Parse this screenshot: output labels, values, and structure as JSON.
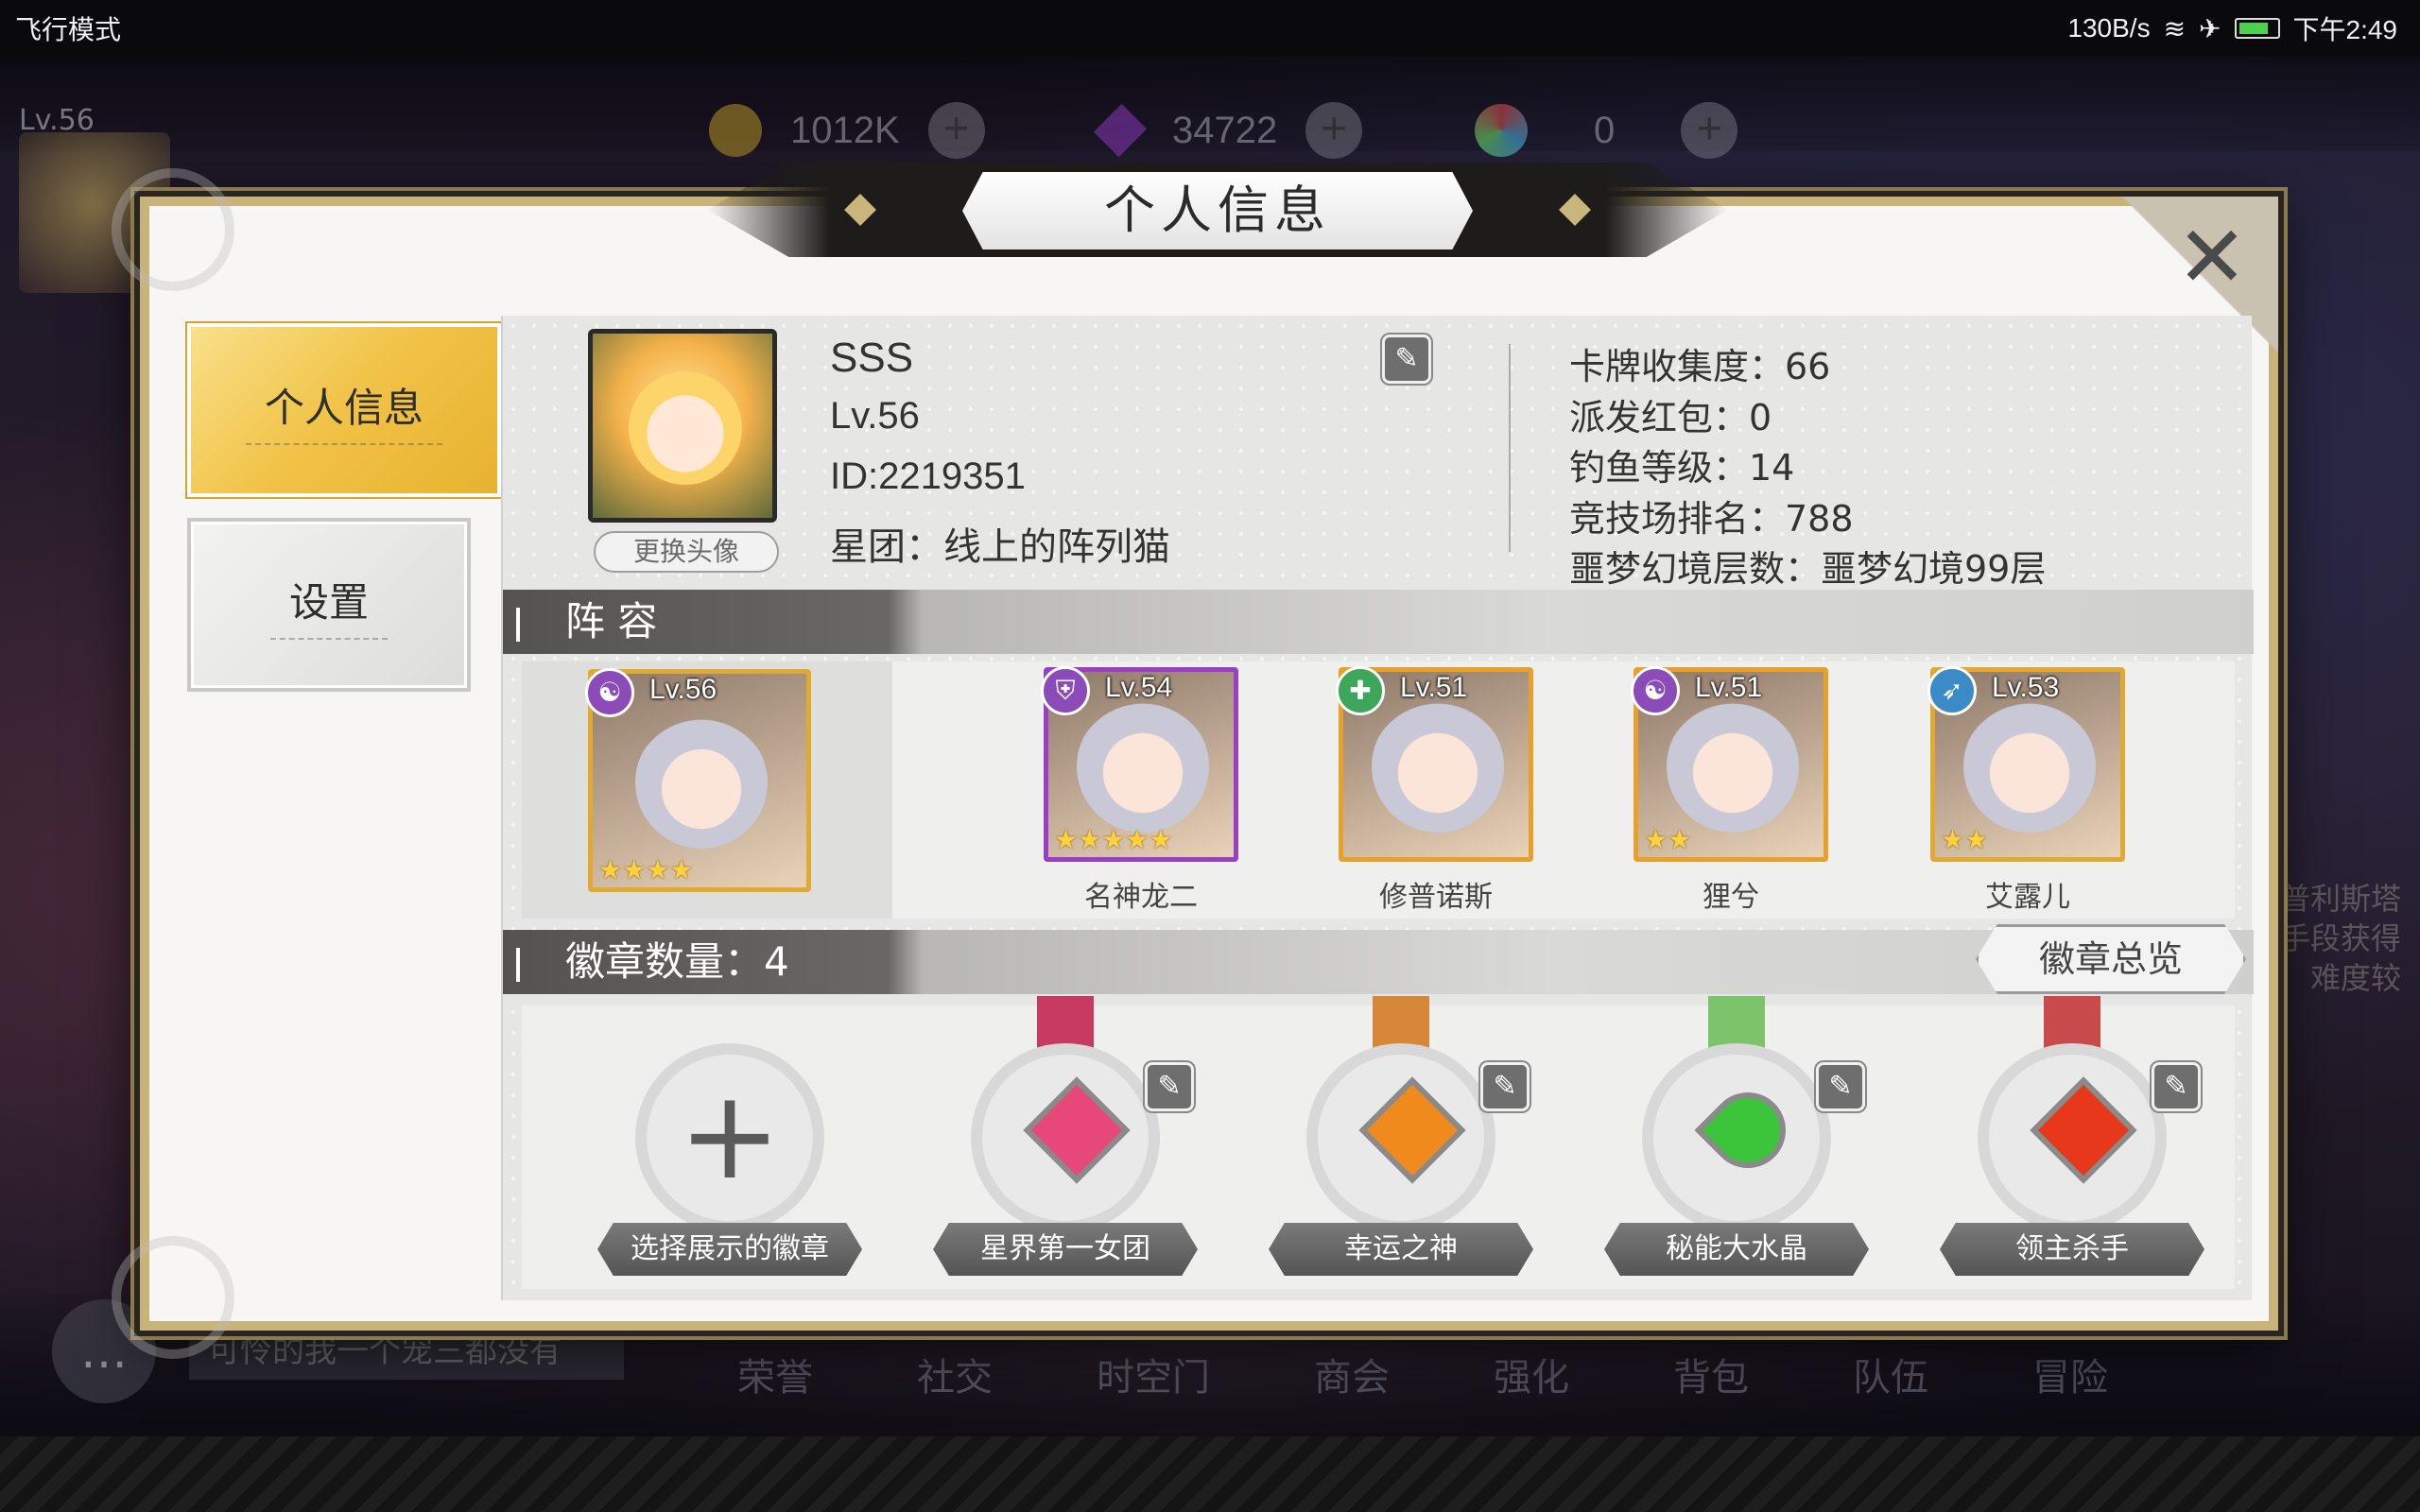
{
  "statusbar": {
    "left": "飞行模式",
    "speed": "130B/s",
    "time": "下午2:49"
  },
  "hud": {
    "level": "Lv.56",
    "gold": "1012K",
    "gems": "34722",
    "orbs": "0",
    "plus": "+"
  },
  "bottom_nav": {
    "items": [
      "荣誉",
      "社交",
      "时空门",
      "商会",
      "强化",
      "背包",
      "队伍",
      "冒险"
    ],
    "chat_placeholder": "可怜的我一个宠三都没有",
    "right_ghost_lines": [
      "普利斯塔",
      "手段获得",
      "难度较"
    ]
  },
  "dialog": {
    "title": "个人信息",
    "close": "✕",
    "tabs": {
      "profile": "个人信息",
      "settings": "设置"
    },
    "profile": {
      "name": "SSS",
      "level": "Lv.56",
      "id": "ID:2219351",
      "guild": "星团：线上的阵列猫",
      "change_avatar": "更换头像"
    },
    "stats": [
      "卡牌收集度：66",
      "派发红包：0",
      "钓鱼等级：14",
      "竞技场排名：788",
      "噩梦幻境层数：噩梦幻境99层"
    ],
    "lineup": {
      "title": "阵 容",
      "heroes": [
        {
          "level": "Lv.56",
          "stars": "★★★★",
          "name": "",
          "class_icon": "spiral-icon"
        },
        {
          "level": "Lv.54",
          "stars": "★★★★★",
          "name": "名神龙二",
          "class_icon": "shield-icon"
        },
        {
          "level": "Lv.51",
          "stars": "",
          "name": "修普诺斯",
          "class_icon": "cross-icon"
        },
        {
          "level": "Lv.51",
          "stars": "★★",
          "name": "狸兮",
          "class_icon": "spiral-icon"
        },
        {
          "level": "Lv.53",
          "stars": "★★",
          "name": "艾露儿",
          "class_icon": "bow-icon"
        }
      ]
    },
    "badges": {
      "title": "徽章数量：4",
      "overview": "徽章总览",
      "items": [
        {
          "label": "选择展示的徽章",
          "gem_color": "",
          "ribbon_color": ""
        },
        {
          "label": "星界第一女团",
          "gem_color": "#e8477a",
          "ribbon_color": "#c83a62"
        },
        {
          "label": "幸运之神",
          "gem_color": "#f08a1c",
          "ribbon_color": "#d68838"
        },
        {
          "label": "秘能大水晶",
          "gem_color": "#3cc53a",
          "ribbon_color": "#7cc46a"
        },
        {
          "label": "领主杀手",
          "gem_color": "#e8381c",
          "ribbon_color": "#c84a4a"
        }
      ]
    }
  }
}
